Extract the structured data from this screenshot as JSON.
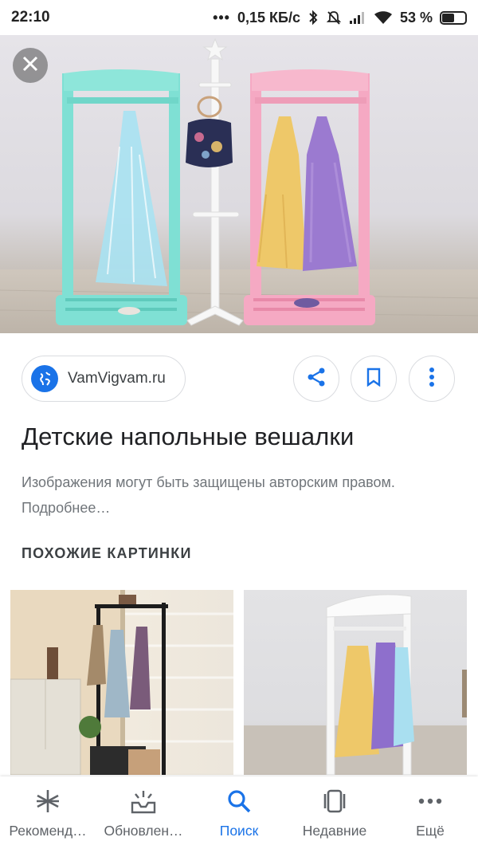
{
  "status_bar": {
    "time": "22:10",
    "dots": "•••",
    "net_speed": "0,15 КБ/с",
    "battery": "53 %",
    "battery_level": 0.53
  },
  "hero": {
    "image_alt": "Детские напольные вешалки",
    "close_icon": "close-icon"
  },
  "source": {
    "label": "VamVigvam.ru",
    "icon": "globe-icon"
  },
  "actions": {
    "share_icon": "share-icon",
    "bookmark_icon": "bookmark-icon",
    "more_icon": "more-vert-icon"
  },
  "title": "Детские напольные вешалки",
  "copyright": "Изображения могут быть защищены авторским правом. Подробнее…",
  "similar": {
    "heading": "ПОХОЖИЕ КАРТИНКИ"
  },
  "nav": {
    "items": [
      {
        "label": "Рекоменд…",
        "icon": "asterisk-icon"
      },
      {
        "label": "Обновлен…",
        "icon": "updates-icon"
      },
      {
        "label": "Поиск",
        "icon": "search-icon"
      },
      {
        "label": "Недавние",
        "icon": "recent-icon"
      },
      {
        "label": "Ещё",
        "icon": "more-horiz-icon"
      }
    ]
  },
  "colors": {
    "accent": "#1a73e8",
    "text": "#202124",
    "secondary": "#70757a"
  }
}
